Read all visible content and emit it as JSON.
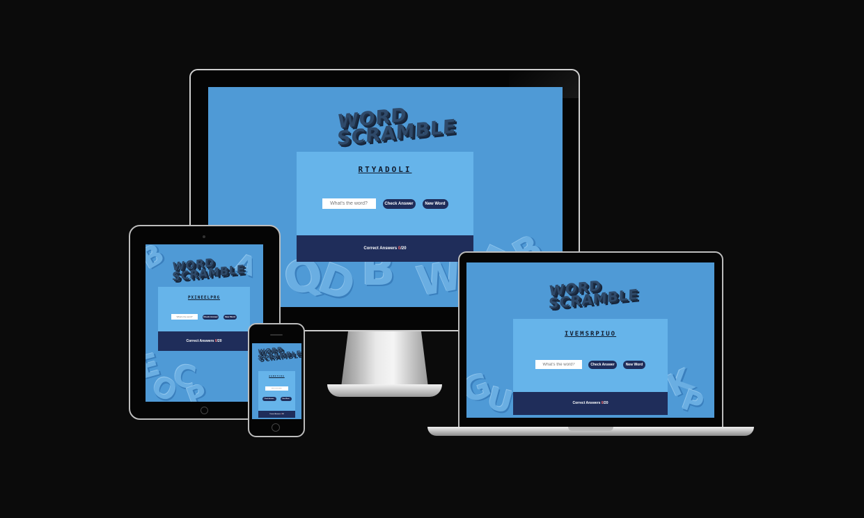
{
  "app": {
    "logo_line1": "WORD",
    "logo_line2": "SCRAMBLE",
    "input_placeholder": "What's the word?",
    "check_label": "Check Answer",
    "new_label": "New Word",
    "score_label": "Correct Answers",
    "score_value": "0",
    "score_total": "/20"
  },
  "desktop": {
    "scrambled_word": "RTYADOLI"
  },
  "laptop": {
    "scrambled_word": "IVEMSRPIUO"
  },
  "tablet": {
    "scrambled_word": "PXINEELPRG"
  },
  "phone": {
    "scrambled_word": "AGNSTCRA"
  },
  "colors": {
    "page_background": "#0b0b0b",
    "screen_background": "#4f9ad6",
    "card_background": "#66b4ea",
    "navy": "#1f2d5a",
    "score_accent": "#ff6b6b"
  }
}
